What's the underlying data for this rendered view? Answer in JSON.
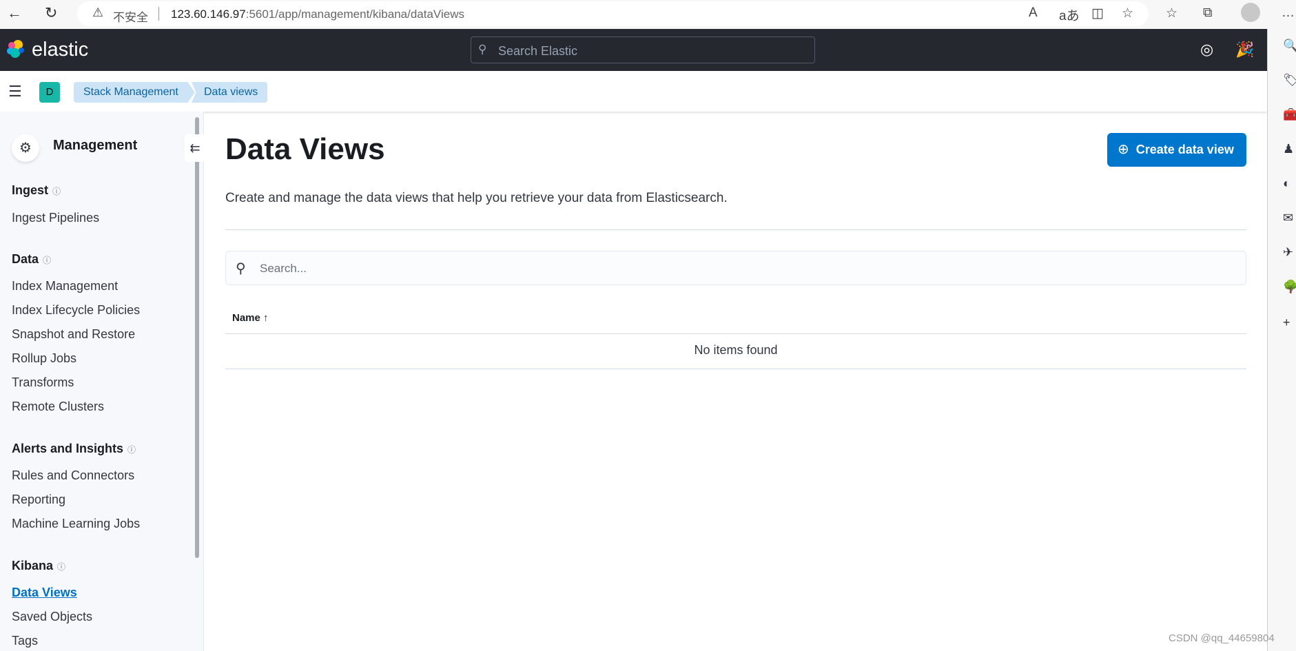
{
  "browser": {
    "insecure_label": "不安全",
    "url_host": "123.60.146.97",
    "url_rest": ":5601/app/management/kibana/dataViews"
  },
  "header": {
    "logo_text": "elastic",
    "search_placeholder": "Search Elastic"
  },
  "breadcrumbs": {
    "space_initial": "D",
    "items": [
      "Stack Management",
      "Data views"
    ]
  },
  "sidebar": {
    "title": "Management",
    "sections": [
      {
        "label": "Ingest",
        "items": [
          "Ingest Pipelines"
        ]
      },
      {
        "label": "Data",
        "items": [
          "Index Management",
          "Index Lifecycle Policies",
          "Snapshot and Restore",
          "Rollup Jobs",
          "Transforms",
          "Remote Clusters"
        ]
      },
      {
        "label": "Alerts and Insights",
        "items": [
          "Rules and Connectors",
          "Reporting",
          "Machine Learning Jobs"
        ]
      },
      {
        "label": "Kibana",
        "items": [
          "Data Views",
          "Saved Objects",
          "Tags"
        ],
        "active": "Data Views"
      }
    ]
  },
  "main": {
    "title": "Data Views",
    "create_button": "Create data view",
    "description": "Create and manage the data views that help you retrieve your data from Elasticsearch.",
    "search_placeholder": "Search...",
    "column_name": "Name",
    "sort_icon": "↑",
    "empty_text": "No items found"
  },
  "watermark": "CSDN @qq_44659804",
  "colors": {
    "header_bg": "#25282f",
    "primary": "#0077cc",
    "breadcrumb_bg": "#cce4f5",
    "space_avatar": "#18b7a8"
  }
}
